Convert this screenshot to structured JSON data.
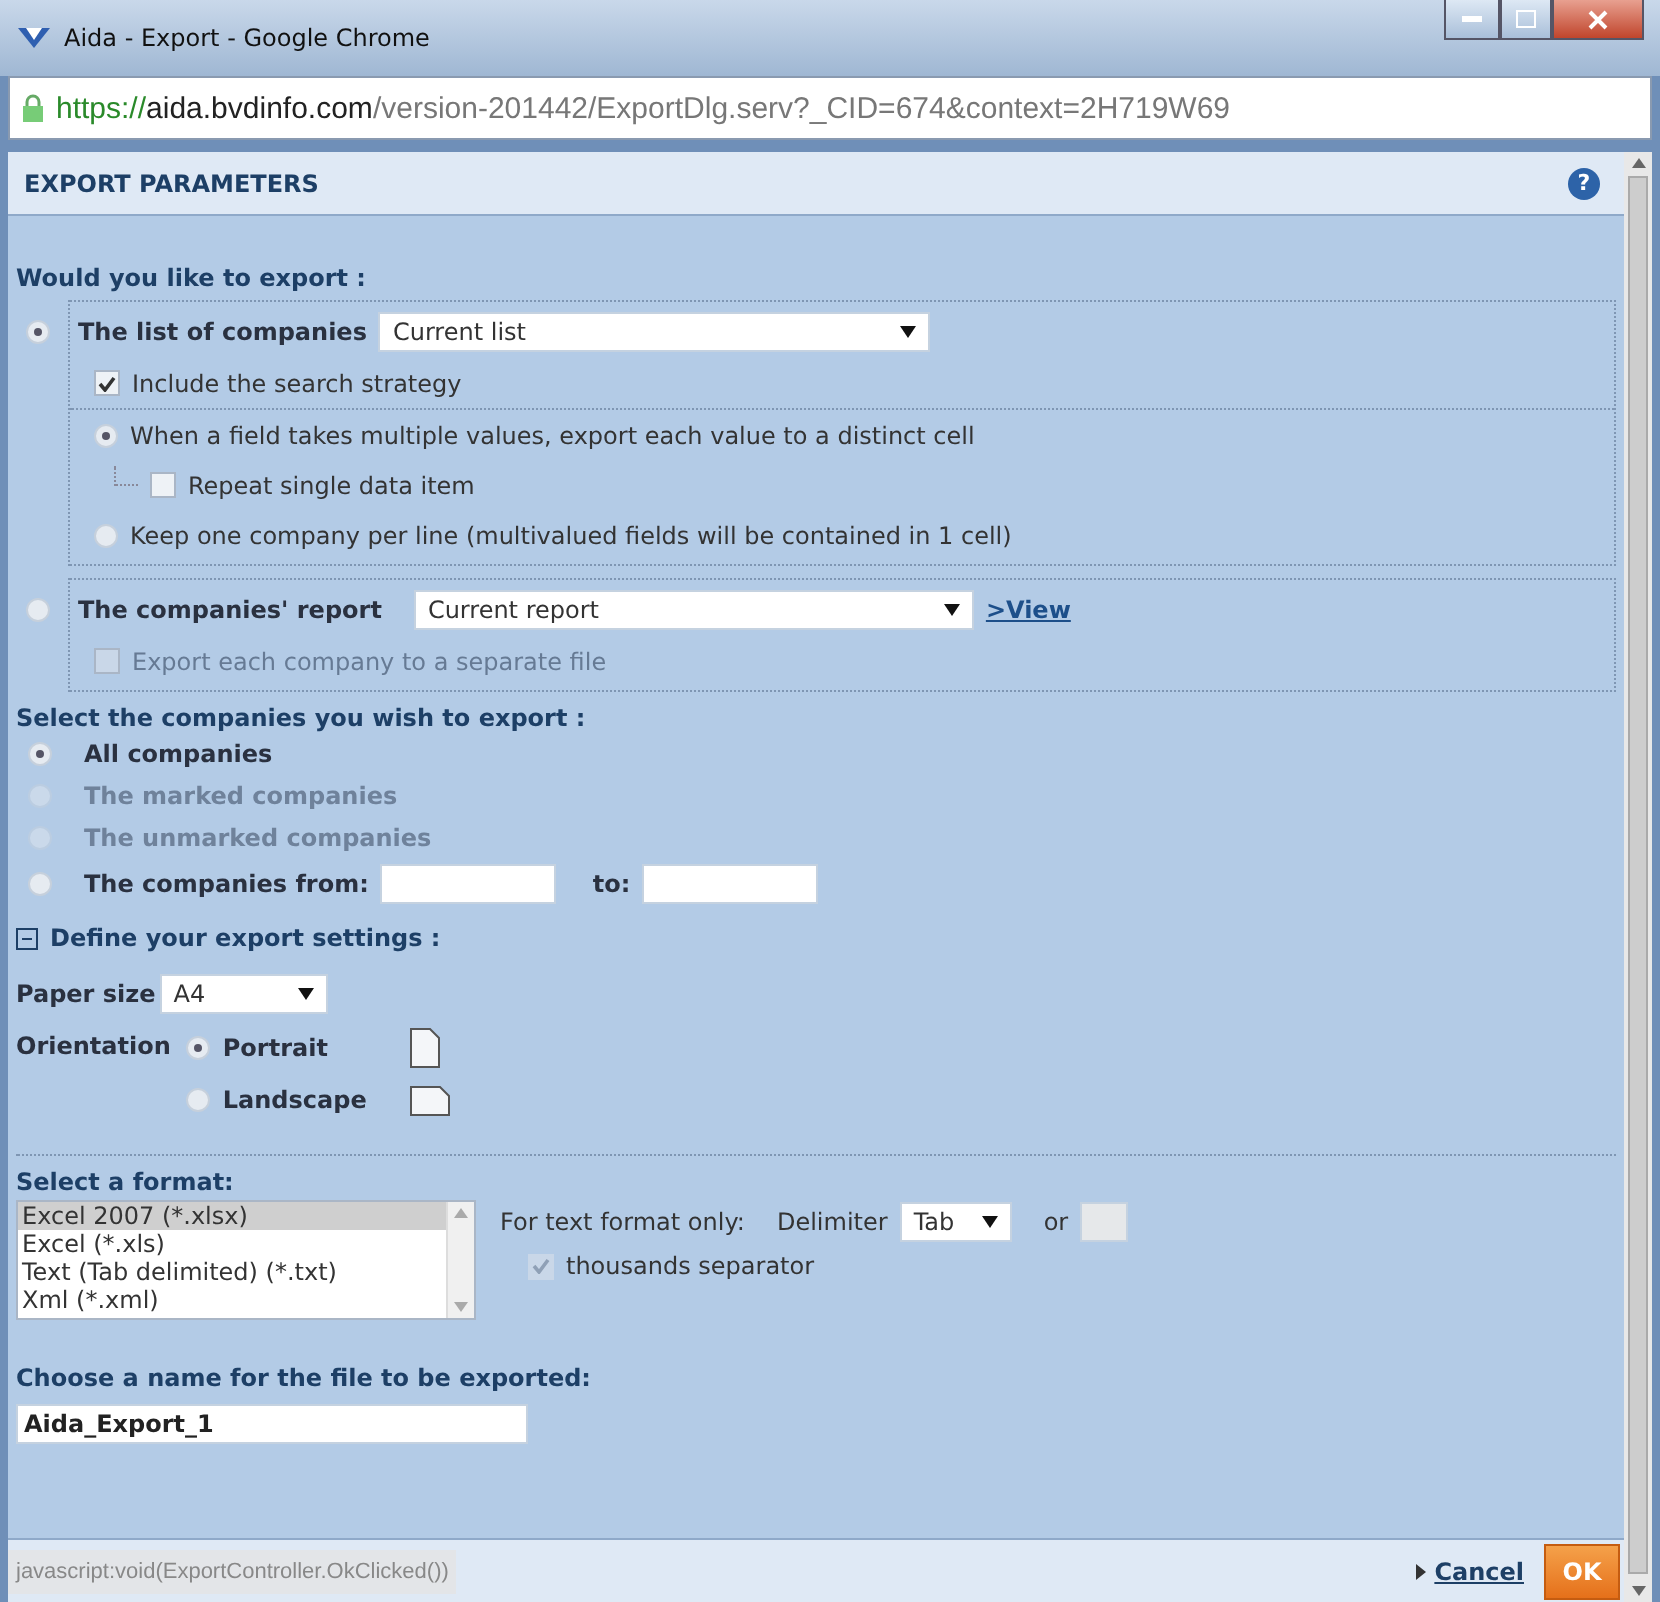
{
  "window": {
    "title": "Aida - Export - Google Chrome"
  },
  "address_bar": {
    "scheme": "https://",
    "host": "aida.bvdinfo.com",
    "path": "/version-201442/ExportDlg.serv?_CID=674&context=2H719W69"
  },
  "dialog": {
    "title": "EXPORT PARAMETERS",
    "help": "?"
  },
  "export": {
    "heading": "Would you like to export :",
    "list_option": {
      "label": "The list of companies",
      "selected": true,
      "dropdown": "Current list",
      "include_strategy": {
        "label": "Include the search strategy",
        "checked": true
      },
      "layout_options": [
        {
          "label": "When a field takes multiple values, export each value to a distinct cell",
          "selected": true,
          "sub": {
            "label": "Repeat single data item",
            "checked": false
          }
        },
        {
          "label": "Keep one company per line (multivalued fields will be contained in 1 cell)",
          "selected": false
        }
      ]
    },
    "report_option": {
      "label": "The companies' report",
      "selected": false,
      "dropdown": "Current report",
      "link": ">View",
      "separate_file": {
        "label": "Export each company to a separate file",
        "checked": false,
        "disabled": true
      }
    }
  },
  "companies": {
    "heading": "Select the companies you wish to export :",
    "options": [
      {
        "kind": "plain",
        "label": "All companies",
        "selected": true,
        "disabled": false
      },
      {
        "kind": "plain",
        "label": "The marked companies",
        "selected": false,
        "disabled": true
      },
      {
        "kind": "plain",
        "label": "The unmarked companies",
        "selected": false,
        "disabled": true
      },
      {
        "kind": "range",
        "label": "The companies from:",
        "to_label": "to:",
        "selected": false,
        "disabled": false
      }
    ]
  },
  "settings": {
    "heading": "Define your export settings :",
    "expanded": true,
    "paper_size": {
      "label": "Paper size",
      "value": "A4"
    },
    "orientation": {
      "label": "Orientation",
      "options": [
        {
          "kind": "portrait",
          "label": "Portrait",
          "selected": true
        },
        {
          "kind": "landscape",
          "label": "Landscape",
          "selected": false
        }
      ]
    }
  },
  "format": {
    "heading": "Select a format:",
    "items": [
      {
        "label": "Excel 2007 (*.xlsx)",
        "selected": true
      },
      {
        "label": "Excel (*.xls)",
        "selected": false
      },
      {
        "label": "Text (Tab delimited) (*.txt)",
        "selected": false
      },
      {
        "label": "Xml (*.xml)",
        "selected": false
      }
    ],
    "text_only_label": "For text format only:",
    "delimiter_label": "Delimiter",
    "delimiter_value": "Tab",
    "or_label": "or",
    "thousands": {
      "label": "thousands separator",
      "checked": true,
      "disabled": true
    }
  },
  "file_name": {
    "heading": "Choose a name for the file to be exported:",
    "value": "Aida_Export_1"
  },
  "status_bar": {
    "text": "javascript:void(ExportController.OkClicked())"
  },
  "buttons": {
    "cancel": "Cancel",
    "ok": "OK"
  }
}
